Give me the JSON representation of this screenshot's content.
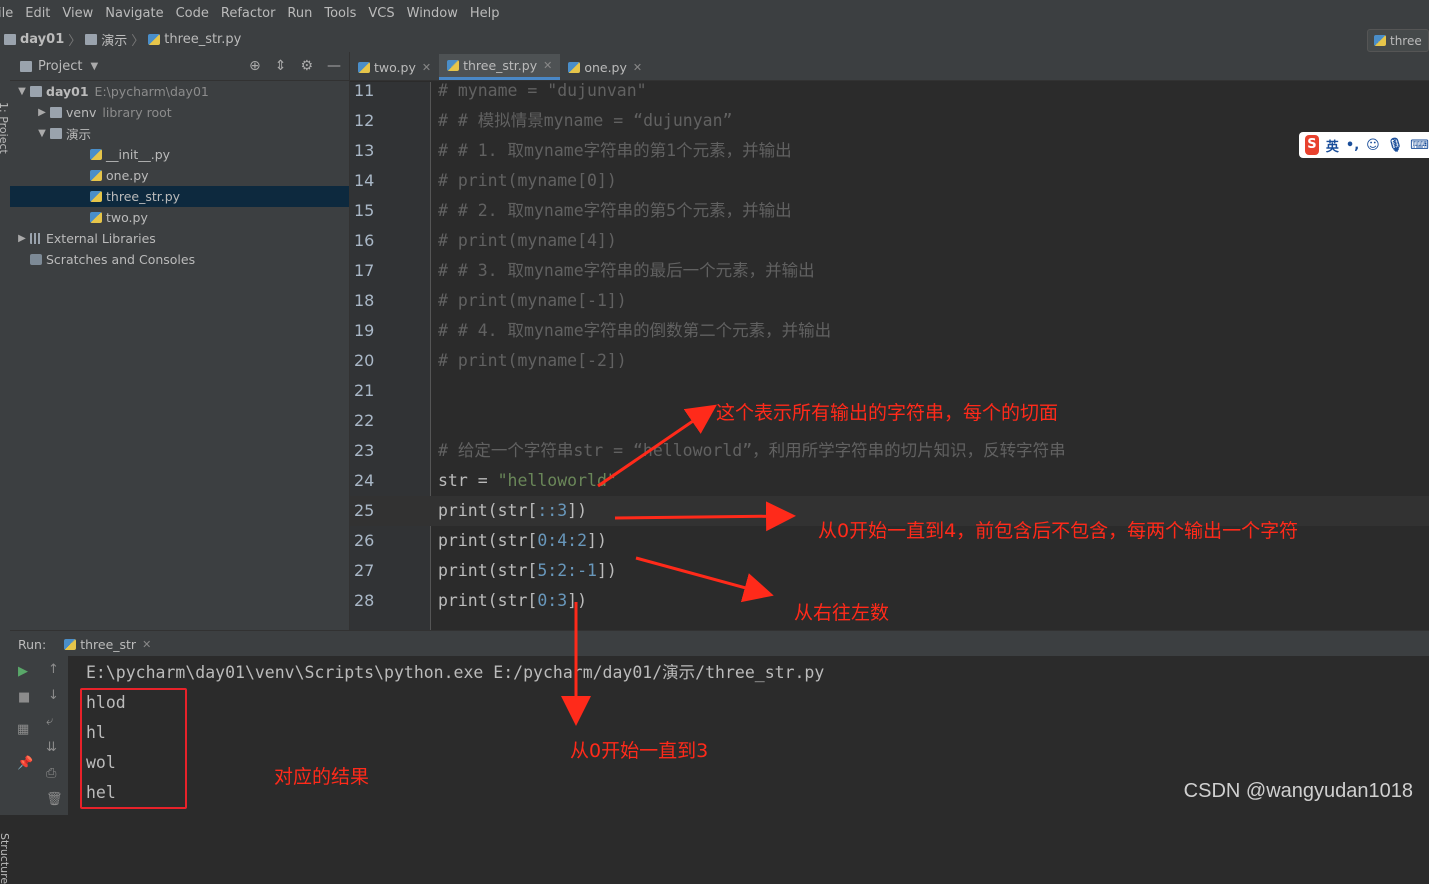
{
  "menu": [
    "ile",
    "Edit",
    "View",
    "Navigate",
    "Code",
    "Refactor",
    "Run",
    "Tools",
    "VCS",
    "Window",
    "Help"
  ],
  "breadcrumb": {
    "root": "day01",
    "folder": "演示",
    "file": "three_str.py",
    "right_tab": "three"
  },
  "side_tabs": {
    "project": "1: Project",
    "structure": "Structure"
  },
  "project_panel": {
    "title": "Project",
    "tree": [
      {
        "label": "day01",
        "extra": "E:\\pycharm\\day01",
        "indent": 0,
        "arrow": "▼",
        "icon": "folder"
      },
      {
        "label": "venv",
        "extra": "library root",
        "indent": 1,
        "arrow": "▶",
        "icon": "folder"
      },
      {
        "label": "演示",
        "extra": "",
        "indent": 1,
        "arrow": "▼",
        "icon": "folder"
      },
      {
        "label": "__init__.py",
        "extra": "",
        "indent": 2,
        "arrow": "",
        "icon": "py"
      },
      {
        "label": "one.py",
        "extra": "",
        "indent": 2,
        "arrow": "",
        "icon": "py"
      },
      {
        "label": "three_str.py",
        "extra": "",
        "indent": 2,
        "arrow": "",
        "icon": "py",
        "selected": true
      },
      {
        "label": "two.py",
        "extra": "",
        "indent": 2,
        "arrow": "",
        "icon": "py"
      },
      {
        "label": "External Libraries",
        "extra": "",
        "indent": 0,
        "arrow": "▶",
        "icon": "lib"
      },
      {
        "label": "Scratches and Consoles",
        "extra": "",
        "indent": 0,
        "arrow": "",
        "icon": "scratch"
      }
    ]
  },
  "editor_tabs": [
    {
      "label": "two.py",
      "active": false
    },
    {
      "label": "three_str.py",
      "active": true
    },
    {
      "label": "one.py",
      "active": false
    }
  ],
  "code_lines": [
    {
      "n": "11",
      "text": "# myname = \"dujunvan\"",
      "type": "cmt"
    },
    {
      "n": "12",
      "text": "# # 模拟情景myname = “dujunyan”",
      "type": "cmt"
    },
    {
      "n": "13",
      "text": "# # 1. 取myname字符串的第1个元素，并输出",
      "type": "cmt"
    },
    {
      "n": "14",
      "text": "# print(myname[0])",
      "type": "cmt"
    },
    {
      "n": "15",
      "text": "# # 2. 取myname字符串的第5个元素，并输出",
      "type": "cmt"
    },
    {
      "n": "16",
      "text": "# print(myname[4])",
      "type": "cmt"
    },
    {
      "n": "17",
      "text": "# # 3. 取myname字符串的最后一个元素，并输出",
      "type": "cmt"
    },
    {
      "n": "18",
      "text": "# print(myname[-1])",
      "type": "cmt"
    },
    {
      "n": "19",
      "text": "# # 4. 取myname字符串的倒数第二个元素，并输出",
      "type": "cmt"
    },
    {
      "n": "20",
      "text": "# print(myname[-2])",
      "type": "cmt"
    },
    {
      "n": "21",
      "text": "",
      "type": "cmt"
    },
    {
      "n": "22",
      "text": "",
      "type": "cmt"
    },
    {
      "n": "23",
      "text": "# 给定一个字符串str = “helloworld”，利用所学字符串的切片知识，反转字符串",
      "type": "cmt"
    },
    {
      "n": "24",
      "text": "str = \"helloworld\"",
      "type": "assign"
    },
    {
      "n": "25",
      "text": "print(str[::3])",
      "type": "print",
      "current": true
    },
    {
      "n": "26",
      "text": "print(str[0:4:2])",
      "type": "print"
    },
    {
      "n": "27",
      "text": "print(str[5:2:-1])",
      "type": "print"
    },
    {
      "n": "28",
      "text": "print(str[0:3])",
      "type": "print"
    }
  ],
  "ime": {
    "logo": "S",
    "label": "英"
  },
  "run_panel": {
    "label": "Run:",
    "tab": "three_str"
  },
  "console_lines": [
    "E:\\pycharm\\day01\\venv\\Scripts\\python.exe E:/pycharm/day01/演示/three_str.py",
    "hlod",
    "hl",
    "wol",
    "hel"
  ],
  "annotations": {
    "a1": "这个表示所有输出的字符串，每个的切面",
    "a2": "从0开始一直到4，前包含后不包含，每两个输出一个字符",
    "a3": "从右往左数",
    "a4": "从0开始一直到3",
    "a5": "对应的结果"
  },
  "watermark": "CSDN @wangyudan1018",
  "colors": {
    "annotation": "#ff2a1a",
    "comment": "#616161",
    "string": "#6a8759",
    "number": "#6897bb",
    "selection": "#0d293e"
  }
}
